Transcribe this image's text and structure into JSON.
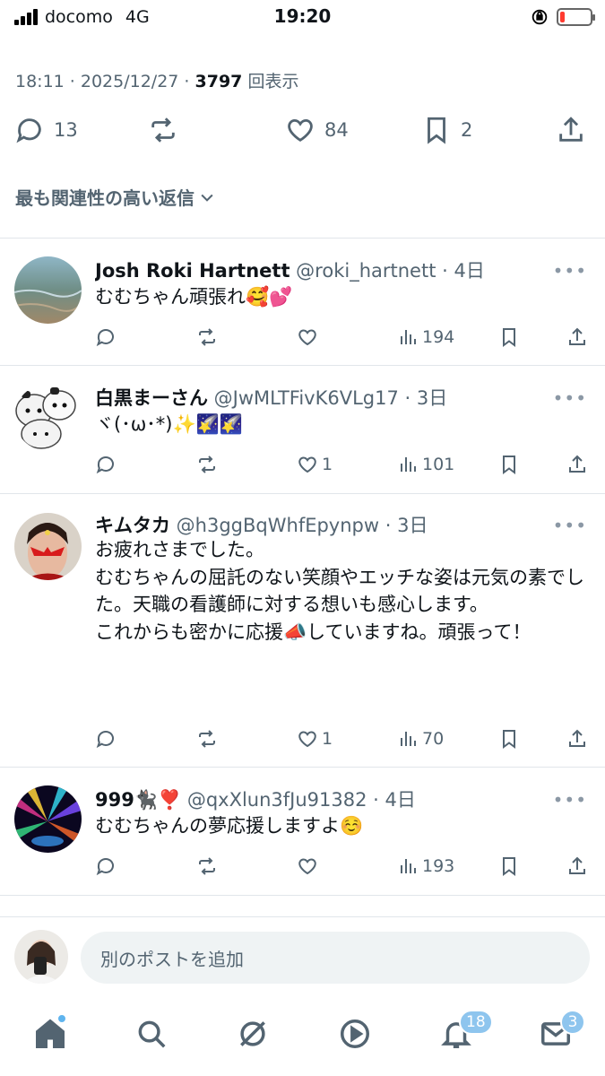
{
  "status_bar": {
    "carrier": "docomo",
    "network": "4G",
    "time": "19:20",
    "battery_level": 0.15
  },
  "post_meta": {
    "time_date": "18:11 · 2025/12/27 · ",
    "views_count": "3797",
    "views_label": " 回表示"
  },
  "action_bar": {
    "replies": "13",
    "retweets": "",
    "likes": "84",
    "bookmarks": "2"
  },
  "sort_label": "最も関連性の高い返信",
  "replies": [
    {
      "name": "Josh Roki Hartnett",
      "handle": " @roki_hartnett · 4日",
      "text": "むむちゃん頑張れ🥰💕",
      "likes": "",
      "views": "194"
    },
    {
      "name": "白黒まーさん",
      "handle": " @JwMLTFivK6VLg17 · 3日",
      "text": "ヾ(･ω･*)✨🌠🌠",
      "likes": "1",
      "views": "101"
    },
    {
      "name": "キムタカ",
      "handle": " @h3ggBqWhfEpynpw · 3日",
      "text": "お疲れさまでした。\nむむちゃんの屈託のない笑顔やエッチな姿は元気の素でした。天職の看護師に対する想いも感心します。\nこれからも密かに応援📣していますね。頑張って！",
      "likes": "1",
      "views": "70"
    },
    {
      "name": "999🐈‍⬛❣️",
      "handle": " @qxXlun3fJu91382 · 4日",
      "text": "むむちゃんの夢応援しますよ☺️",
      "likes": "",
      "views": "193"
    }
  ],
  "compose": {
    "placeholder": "別のポストを追加"
  },
  "tab_bar": {
    "notifications_badge": "18",
    "messages_badge": "3"
  },
  "icons": [
    "reply-icon",
    "retweet-icon",
    "like-icon",
    "bookmark-icon",
    "share-icon",
    "views-icon",
    "more-icon",
    "home-icon",
    "search-icon",
    "grok-icon",
    "video-icon",
    "bell-icon",
    "mail-icon"
  ]
}
